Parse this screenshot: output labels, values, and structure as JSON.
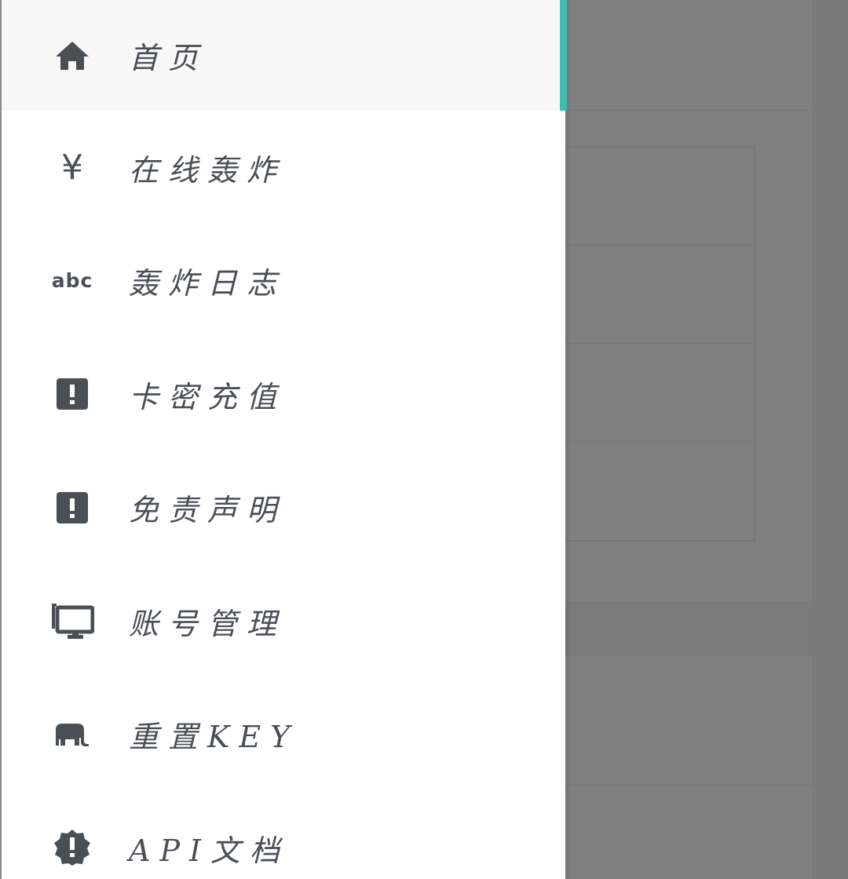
{
  "drawer": {
    "accent_color": "#3cbfae",
    "items": [
      {
        "label": "首页",
        "icon": "home-icon",
        "active": true
      },
      {
        "label": "在线轰炸",
        "icon": "yen-icon",
        "active": false
      },
      {
        "label": "轰炸日志",
        "icon": "abc-icon",
        "active": false
      },
      {
        "label": "卡密充值",
        "icon": "alert-box-icon",
        "active": false
      },
      {
        "label": "免责声明",
        "icon": "alert-box-icon",
        "active": false
      },
      {
        "label": "账号管理",
        "icon": "monitor-icon",
        "active": false
      },
      {
        "label": "重置KEY",
        "icon": "elephant-icon",
        "active": false
      },
      {
        "label": "API文档",
        "icon": "alert-badge-icon",
        "active": false
      }
    ]
  },
  "icons": {
    "yen_glyph": "¥",
    "abc_glyph": "abc"
  }
}
